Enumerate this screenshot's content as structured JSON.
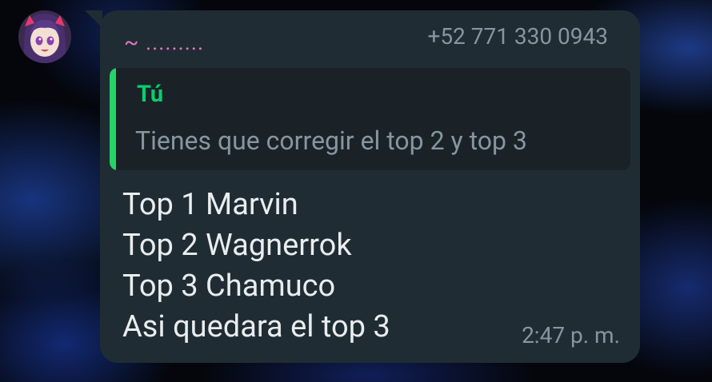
{
  "message": {
    "sender_name": "~ .........",
    "sender_phone": "+52 771 330 0943",
    "quoted": {
      "author": "Tú",
      "text": "Tienes que corregir el top 2 y top 3"
    },
    "lines": [
      "Top 1 Marvin",
      "Top 2 Wagnerrok",
      "Top 3 Chamuco",
      "Asi quedara el top 3"
    ],
    "timestamp": "2:47 p. m."
  },
  "colors": {
    "bubble": "#202c33",
    "sender_name": "#e573c9",
    "quote_author": "#06cf6c",
    "muted_text": "#8696a0",
    "body_text": "#e9edef"
  }
}
